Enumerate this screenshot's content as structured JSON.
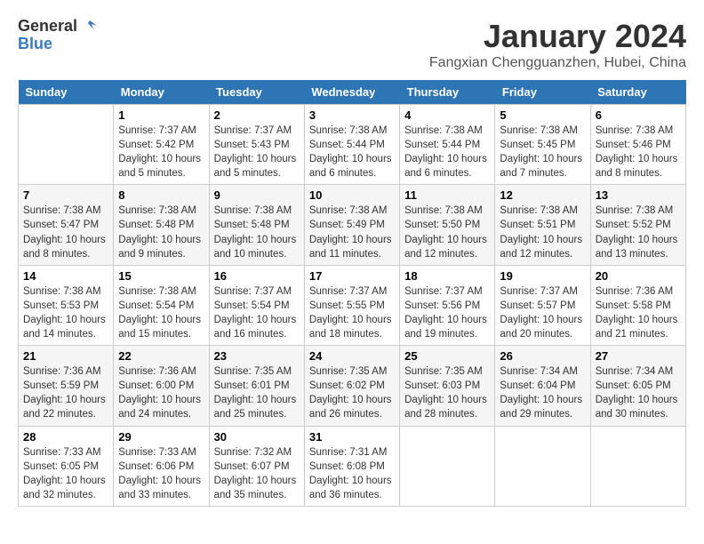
{
  "logo": {
    "general": "General",
    "blue": "Blue"
  },
  "title": "January 2024",
  "subtitle": "Fangxian Chengguanzhen, Hubei, China",
  "days_header": [
    "Sunday",
    "Monday",
    "Tuesday",
    "Wednesday",
    "Thursday",
    "Friday",
    "Saturday"
  ],
  "weeks": [
    [
      {
        "day": "",
        "info": ""
      },
      {
        "day": "1",
        "info": "Sunrise: 7:37 AM\nSunset: 5:42 PM\nDaylight: 10 hours\nand 5 minutes."
      },
      {
        "day": "2",
        "info": "Sunrise: 7:37 AM\nSunset: 5:43 PM\nDaylight: 10 hours\nand 5 minutes."
      },
      {
        "day": "3",
        "info": "Sunrise: 7:38 AM\nSunset: 5:44 PM\nDaylight: 10 hours\nand 6 minutes."
      },
      {
        "day": "4",
        "info": "Sunrise: 7:38 AM\nSunset: 5:44 PM\nDaylight: 10 hours\nand 6 minutes."
      },
      {
        "day": "5",
        "info": "Sunrise: 7:38 AM\nSunset: 5:45 PM\nDaylight: 10 hours\nand 7 minutes."
      },
      {
        "day": "6",
        "info": "Sunrise: 7:38 AM\nSunset: 5:46 PM\nDaylight: 10 hours\nand 8 minutes."
      }
    ],
    [
      {
        "day": "7",
        "info": "Sunrise: 7:38 AM\nSunset: 5:47 PM\nDaylight: 10 hours\nand 8 minutes."
      },
      {
        "day": "8",
        "info": "Sunrise: 7:38 AM\nSunset: 5:48 PM\nDaylight: 10 hours\nand 9 minutes."
      },
      {
        "day": "9",
        "info": "Sunrise: 7:38 AM\nSunset: 5:48 PM\nDaylight: 10 hours\nand 10 minutes."
      },
      {
        "day": "10",
        "info": "Sunrise: 7:38 AM\nSunset: 5:49 PM\nDaylight: 10 hours\nand 11 minutes."
      },
      {
        "day": "11",
        "info": "Sunrise: 7:38 AM\nSunset: 5:50 PM\nDaylight: 10 hours\nand 12 minutes."
      },
      {
        "day": "12",
        "info": "Sunrise: 7:38 AM\nSunset: 5:51 PM\nDaylight: 10 hours\nand 12 minutes."
      },
      {
        "day": "13",
        "info": "Sunrise: 7:38 AM\nSunset: 5:52 PM\nDaylight: 10 hours\nand 13 minutes."
      }
    ],
    [
      {
        "day": "14",
        "info": "Sunrise: 7:38 AM\nSunset: 5:53 PM\nDaylight: 10 hours\nand 14 minutes."
      },
      {
        "day": "15",
        "info": "Sunrise: 7:38 AM\nSunset: 5:54 PM\nDaylight: 10 hours\nand 15 minutes."
      },
      {
        "day": "16",
        "info": "Sunrise: 7:37 AM\nSunset: 5:54 PM\nDaylight: 10 hours\nand 16 minutes."
      },
      {
        "day": "17",
        "info": "Sunrise: 7:37 AM\nSunset: 5:55 PM\nDaylight: 10 hours\nand 18 minutes."
      },
      {
        "day": "18",
        "info": "Sunrise: 7:37 AM\nSunset: 5:56 PM\nDaylight: 10 hours\nand 19 minutes."
      },
      {
        "day": "19",
        "info": "Sunrise: 7:37 AM\nSunset: 5:57 PM\nDaylight: 10 hours\nand 20 minutes."
      },
      {
        "day": "20",
        "info": "Sunrise: 7:36 AM\nSunset: 5:58 PM\nDaylight: 10 hours\nand 21 minutes."
      }
    ],
    [
      {
        "day": "21",
        "info": "Sunrise: 7:36 AM\nSunset: 5:59 PM\nDaylight: 10 hours\nand 22 minutes."
      },
      {
        "day": "22",
        "info": "Sunrise: 7:36 AM\nSunset: 6:00 PM\nDaylight: 10 hours\nand 24 minutes."
      },
      {
        "day": "23",
        "info": "Sunrise: 7:35 AM\nSunset: 6:01 PM\nDaylight: 10 hours\nand 25 minutes."
      },
      {
        "day": "24",
        "info": "Sunrise: 7:35 AM\nSunset: 6:02 PM\nDaylight: 10 hours\nand 26 minutes."
      },
      {
        "day": "25",
        "info": "Sunrise: 7:35 AM\nSunset: 6:03 PM\nDaylight: 10 hours\nand 28 minutes."
      },
      {
        "day": "26",
        "info": "Sunrise: 7:34 AM\nSunset: 6:04 PM\nDaylight: 10 hours\nand 29 minutes."
      },
      {
        "day": "27",
        "info": "Sunrise: 7:34 AM\nSunset: 6:05 PM\nDaylight: 10 hours\nand 30 minutes."
      }
    ],
    [
      {
        "day": "28",
        "info": "Sunrise: 7:33 AM\nSunset: 6:05 PM\nDaylight: 10 hours\nand 32 minutes."
      },
      {
        "day": "29",
        "info": "Sunrise: 7:33 AM\nSunset: 6:06 PM\nDaylight: 10 hours\nand 33 minutes."
      },
      {
        "day": "30",
        "info": "Sunrise: 7:32 AM\nSunset: 6:07 PM\nDaylight: 10 hours\nand 35 minutes."
      },
      {
        "day": "31",
        "info": "Sunrise: 7:31 AM\nSunset: 6:08 PM\nDaylight: 10 hours\nand 36 minutes."
      },
      {
        "day": "",
        "info": ""
      },
      {
        "day": "",
        "info": ""
      },
      {
        "day": "",
        "info": ""
      }
    ]
  ]
}
